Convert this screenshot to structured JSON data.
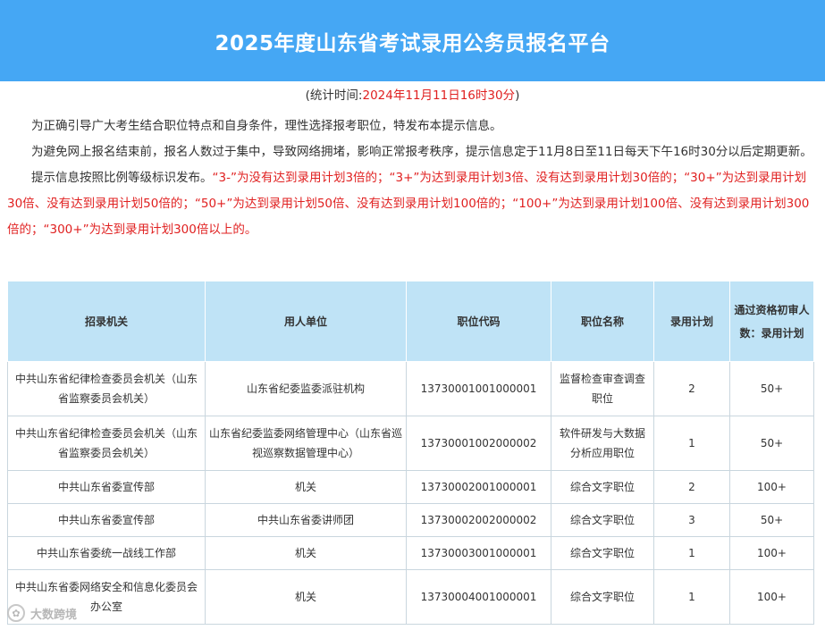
{
  "header": {
    "title": "2025年度山东省考试录用公务员报名平台"
  },
  "stat_time": {
    "prefix": "(统计时间:",
    "value": "2024年11月11日16时30分",
    "suffix": ")"
  },
  "notice": {
    "p1": "为正确引导广大考生结合职位特点和自身条件，理性选择报考职位，特发布本提示信息。",
    "p2": "为避免网上报名结束前，报名人数过于集中，导致网络拥堵，影响正常报考秩序，提示信息定于11月8日至11日每天下午16时30分以后定期更新。",
    "p3_black": "提示信息按照比例等级标识发布。",
    "p3_red": "“3-”为没有达到录用计划3倍的；“3+”为达到录用计划3倍、没有达到录用计划30倍的；“30+”为达到录用计划30倍、没有达到录用计划50倍的；“50+”为达到录用计划50倍、没有达到录用计划100倍的；“100+”为达到录用计划100倍、没有达到录用计划300倍的；“300+”为达到录用计划300倍以上的。"
  },
  "table": {
    "headers": [
      "招录机关",
      "用人单位",
      "职位代码",
      "职位名称",
      "录用计划",
      "通过资格初审人数：录用计划"
    ],
    "rows": [
      [
        "中共山东省纪律检查委员会机关（山东省监察委员会机关）",
        "山东省纪委监委派驻机构",
        "13730001001000001",
        "监督检查审查调查职位",
        "2",
        "50+"
      ],
      [
        "中共山东省纪律检查委员会机关（山东省监察委员会机关）",
        "山东省纪委监委网络管理中心（山东省巡视巡察数据管理中心）",
        "13730001002000002",
        "软件研发与大数据分析应用职位",
        "1",
        "50+"
      ],
      [
        "中共山东省委宣传部",
        "机关",
        "13730002001000001",
        "综合文字职位",
        "2",
        "100+"
      ],
      [
        "中共山东省委宣传部",
        "中共山东省委讲师团",
        "13730002002000002",
        "综合文字职位",
        "3",
        "50+"
      ],
      [
        "中共山东省委统一战线工作部",
        "机关",
        "13730003001000001",
        "综合文字职位",
        "1",
        "100+"
      ],
      [
        "中共山东省委网络安全和信息化委员会办公室",
        "机关",
        "13730004001000001",
        "综合文字职位",
        "1",
        "100+"
      ]
    ]
  },
  "watermark": {
    "icon": "app-logo-icon",
    "text": "大数跨境"
  },
  "colors": {
    "header_bg": "#45a7f4",
    "table_header_bg": "#bfe3f6",
    "highlight_red": "#e02020"
  }
}
